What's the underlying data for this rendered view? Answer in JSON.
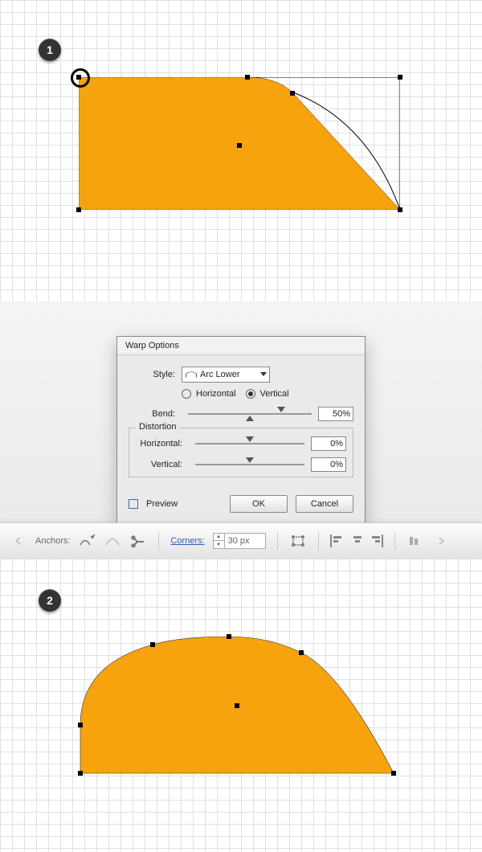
{
  "step1": {
    "badge": "1"
  },
  "step2": {
    "badge": "2"
  },
  "dialog": {
    "title": "Warp Options",
    "style_label": "Style:",
    "style_value": "Arc Lower",
    "orient": {
      "horizontal": "Horizontal",
      "vertical": "Vertical",
      "selected": "vertical"
    },
    "bend_label": "Bend:",
    "bend_value": "50%",
    "distortion_label": "Distortion",
    "dh_label": "Horizontal:",
    "dh_value": "0%",
    "dv_label": "Vertical:",
    "dv_value": "0%",
    "preview_label": "Preview",
    "ok_label": "OK",
    "cancel_label": "Cancel"
  },
  "toolbar": {
    "anchors_label": "Anchors:",
    "corners_label": "Corners:",
    "corners_value": "30 px"
  },
  "shape_color": "#f7a30e",
  "chart_data": {
    "type": "shape",
    "note": "Illustrator warp transformation demo",
    "warp_style": "Arc Lower",
    "warp_axis": "Vertical",
    "bend_percent": 50,
    "distortion_horizontal_percent": 0,
    "distortion_vertical_percent": 0,
    "corner_radius_px": 30
  }
}
